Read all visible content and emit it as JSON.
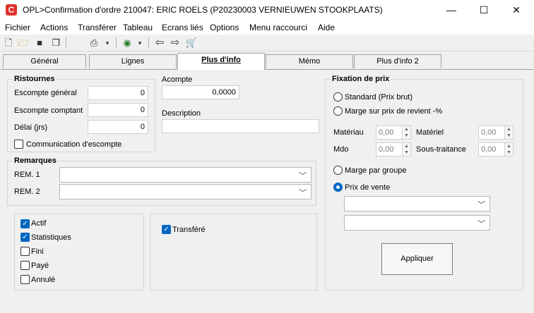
{
  "window": {
    "title": "OPL>Confirmation d'ordre 210047: ERIC ROELS (P20230003 VERNIEUWEN STOOKPLAATS)",
    "app_icon_letter": "C",
    "controls": {
      "minimize": "—",
      "maximize": "☐",
      "close": "✕"
    }
  },
  "menu": [
    "Fichier",
    "Actions",
    "Transférer",
    "Tableau",
    "Ecrans liés",
    "Options",
    "Menu raccourci",
    "Aide"
  ],
  "toolbar": [
    "new-icon",
    "open-icon",
    "save-icon",
    "copy-icon",
    "print-icon",
    "globe-icon",
    "back-arrow-icon",
    "forward-arrow-icon",
    "cart-icon"
  ],
  "tabs": [
    "Général",
    "Lignes",
    "Plus d'info",
    "Mémo",
    "Plus d'info 2"
  ],
  "active_tab": "Plus d'info",
  "ristournes": {
    "title": "Ristournes",
    "escompte_general": {
      "label": "Escompte général",
      "value": "0"
    },
    "escompte_comptant": {
      "label": "Escompte comptant",
      "value": "0"
    },
    "delai": {
      "label": "Délai (jrs)",
      "value": "0"
    },
    "communication": {
      "label": "Communication d'escompte",
      "checked": false
    }
  },
  "acompte": {
    "label": "Acompte",
    "value": "0,0000"
  },
  "description": {
    "label": "Description",
    "value": ""
  },
  "remarques": {
    "title": "Remarques",
    "rem1": {
      "label": "REM. 1",
      "value": ""
    },
    "rem2": {
      "label": "REM. 2",
      "value": ""
    }
  },
  "status": {
    "actif": {
      "label": "Actif",
      "checked": true
    },
    "statistiques": {
      "label": "Statistiques",
      "checked": true
    },
    "fini": {
      "label": "Fini",
      "checked": false
    },
    "paye": {
      "label": "Payé",
      "checked": false
    },
    "annule": {
      "label": "Annulé",
      "checked": false
    },
    "transfere": {
      "label": "Transféré",
      "checked": true
    }
  },
  "fixation": {
    "title": "Fixation de prix",
    "standard": {
      "label": "Standard (Prix brut)",
      "selected": false
    },
    "marge_revient": {
      "label": "Marge sur prix de revient -%",
      "selected": false
    },
    "materiau": {
      "label": "Matériau",
      "value": "0,00"
    },
    "materiel": {
      "label": "Matériel",
      "value": "0,00"
    },
    "mdo": {
      "label": "Mdo",
      "value": "0,00"
    },
    "sous_traitance": {
      "label": "Sous-traitance",
      "value": "0,00"
    },
    "marge_groupe": {
      "label": "Marge par groupe",
      "selected": false
    },
    "prix_vente": {
      "label": "Prix de vente",
      "selected": true
    },
    "combo1": "",
    "combo2": "",
    "apply_label": "Appliquer"
  },
  "colors": {
    "accent": "#0067c0",
    "brand": "#e0312b"
  }
}
